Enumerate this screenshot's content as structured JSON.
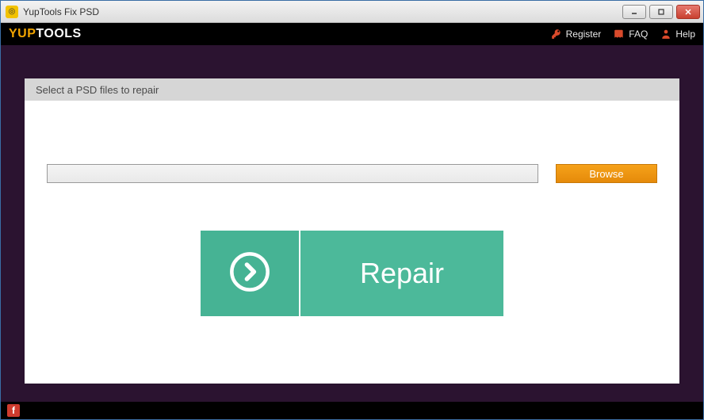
{
  "window": {
    "title": "YupTools Fix PSD"
  },
  "header": {
    "logo_prefix": "YUP",
    "logo_suffix": "TOOLS",
    "register": "Register",
    "faq": "FAQ",
    "help": "Help"
  },
  "panel": {
    "title": "Select a PSD files to repair",
    "file_value": "",
    "browse_label": "Browse",
    "repair_label": "Repair"
  },
  "footer": {
    "social_glyph": "f"
  },
  "colors": {
    "accent_orange": "#f2a500",
    "brand_red": "#d94a2b",
    "teal": "#4cb99a",
    "bg_dark": "#2b1330"
  }
}
